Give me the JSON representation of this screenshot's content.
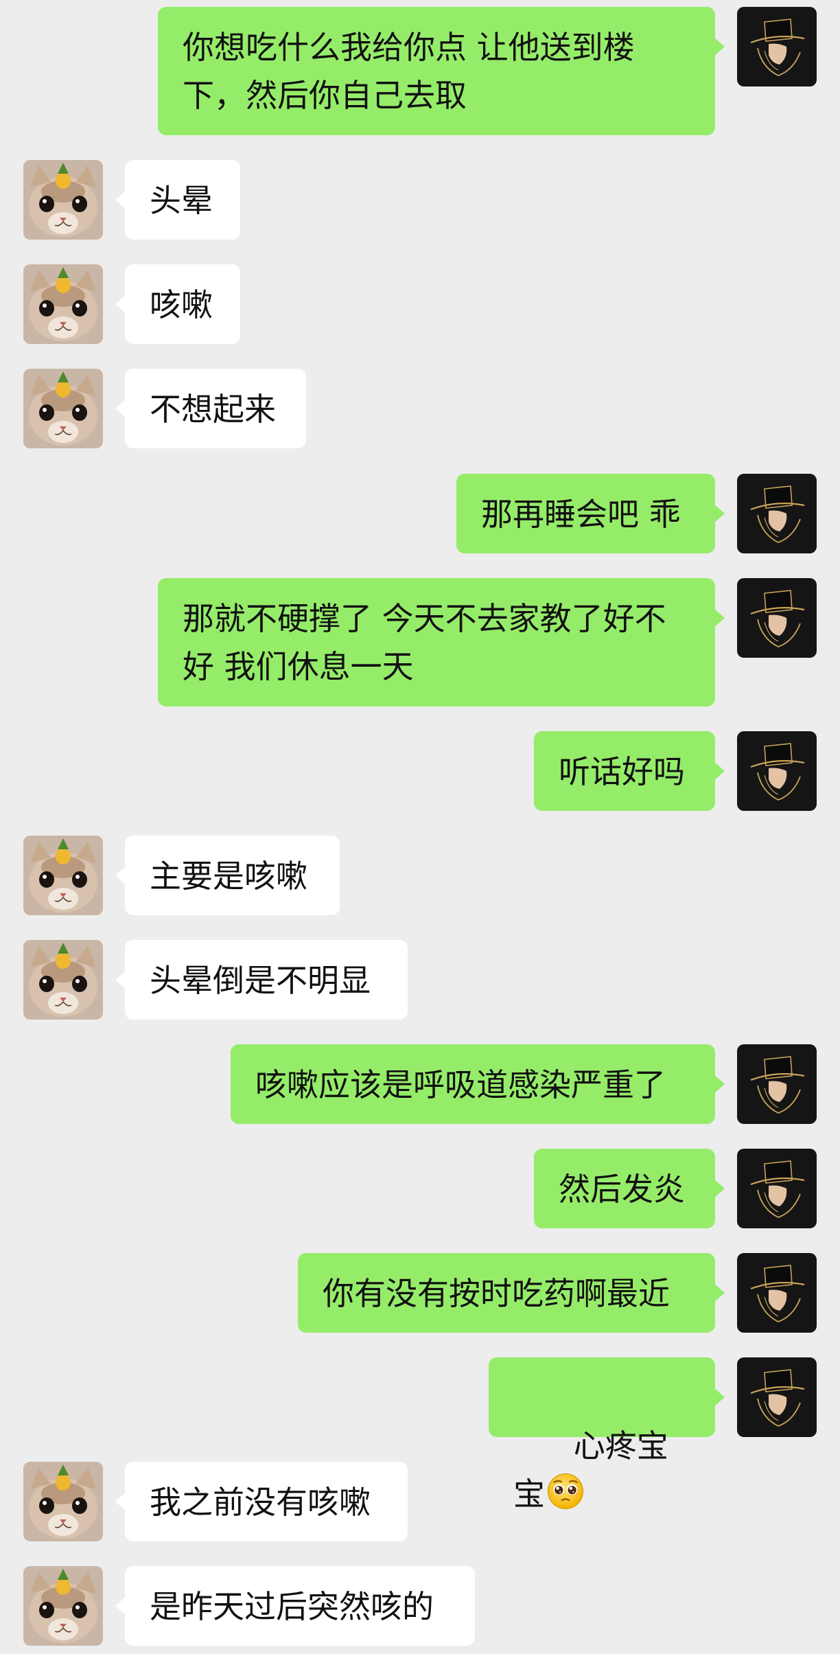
{
  "chat": {
    "messages": [
      {
        "side": "right",
        "text": "你想吃什么我给你点 让他送到楼\n下，然后你自己去取"
      },
      {
        "side": "left",
        "text": "头晕"
      },
      {
        "side": "left",
        "text": "咳嗽"
      },
      {
        "side": "left",
        "text": "不想起来"
      },
      {
        "side": "right",
        "text": "那再睡会吧 乖"
      },
      {
        "side": "right",
        "text": "那就不硬撑了 今天不去家教了好不\n好 我们休息一天"
      },
      {
        "side": "right",
        "text": "听话好吗"
      },
      {
        "side": "left",
        "text": "主要是咳嗽"
      },
      {
        "side": "left",
        "text": "头晕倒是不明显"
      },
      {
        "side": "right",
        "text": "咳嗽应该是呼吸道感染严重了"
      },
      {
        "side": "right",
        "text": "然后发炎"
      },
      {
        "side": "right",
        "text": "你有没有按时吃药啊最近"
      },
      {
        "side": "right",
        "text": "心疼宝宝",
        "emoji": "pleading-face-emoji"
      },
      {
        "side": "left",
        "text": "我之前没有咳嗽"
      },
      {
        "side": "left",
        "text": "是昨天过后突然咳的"
      }
    ]
  },
  "colors": {
    "background": "#ededed",
    "self_bubble": "#95ec69",
    "other_bubble": "#ffffff",
    "text": "#111111"
  },
  "avatars": {
    "self": "hat-figure-avatar",
    "other": "cat-with-pineapple-avatar"
  }
}
